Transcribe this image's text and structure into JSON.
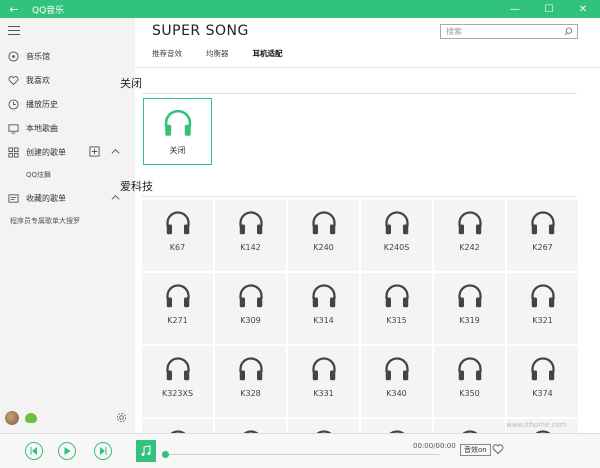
{
  "window": {
    "title": "QQ音乐"
  },
  "sidebar": {
    "items": [
      {
        "label": "音乐馆",
        "icon": "disc-icon"
      },
      {
        "label": "我喜欢",
        "icon": "heart-icon"
      },
      {
        "label": "播放历史",
        "icon": "clock-icon"
      },
      {
        "label": "本地歌曲",
        "icon": "monitor-icon"
      },
      {
        "label": "创建的歌单",
        "icon": "grid-icon"
      }
    ],
    "created_sub": "QQ炫舞",
    "collected": {
      "label": "收藏的歌单",
      "icon": "collection-icon"
    },
    "collected_sub": "程序员专属歌单大搜罗"
  },
  "main": {
    "header_title": "SUPER SONG",
    "search_placeholder": "搜索",
    "tabs": [
      "推荐音效",
      "均衡器",
      "耳机适配"
    ],
    "active_tab": "耳机适配",
    "section_off": "关闭",
    "off_card_label": "关闭",
    "section_brand": "爱科技",
    "headphones": [
      "K67",
      "K142",
      "K240",
      "K240S",
      "K242",
      "K267",
      "K271",
      "K309",
      "K314",
      "K315",
      "K319",
      "K321",
      "K323XS",
      "K328",
      "K331",
      "K340",
      "K350",
      "K374",
      "",
      "",
      "",
      "",
      "",
      ""
    ]
  },
  "player": {
    "time": "00:00/00:00",
    "sound_effect_label": "音效on"
  },
  "watermark": "www.ithome.com",
  "colors": {
    "accent": "#31c27c",
    "sidebar_bg": "#f3f3f3"
  }
}
